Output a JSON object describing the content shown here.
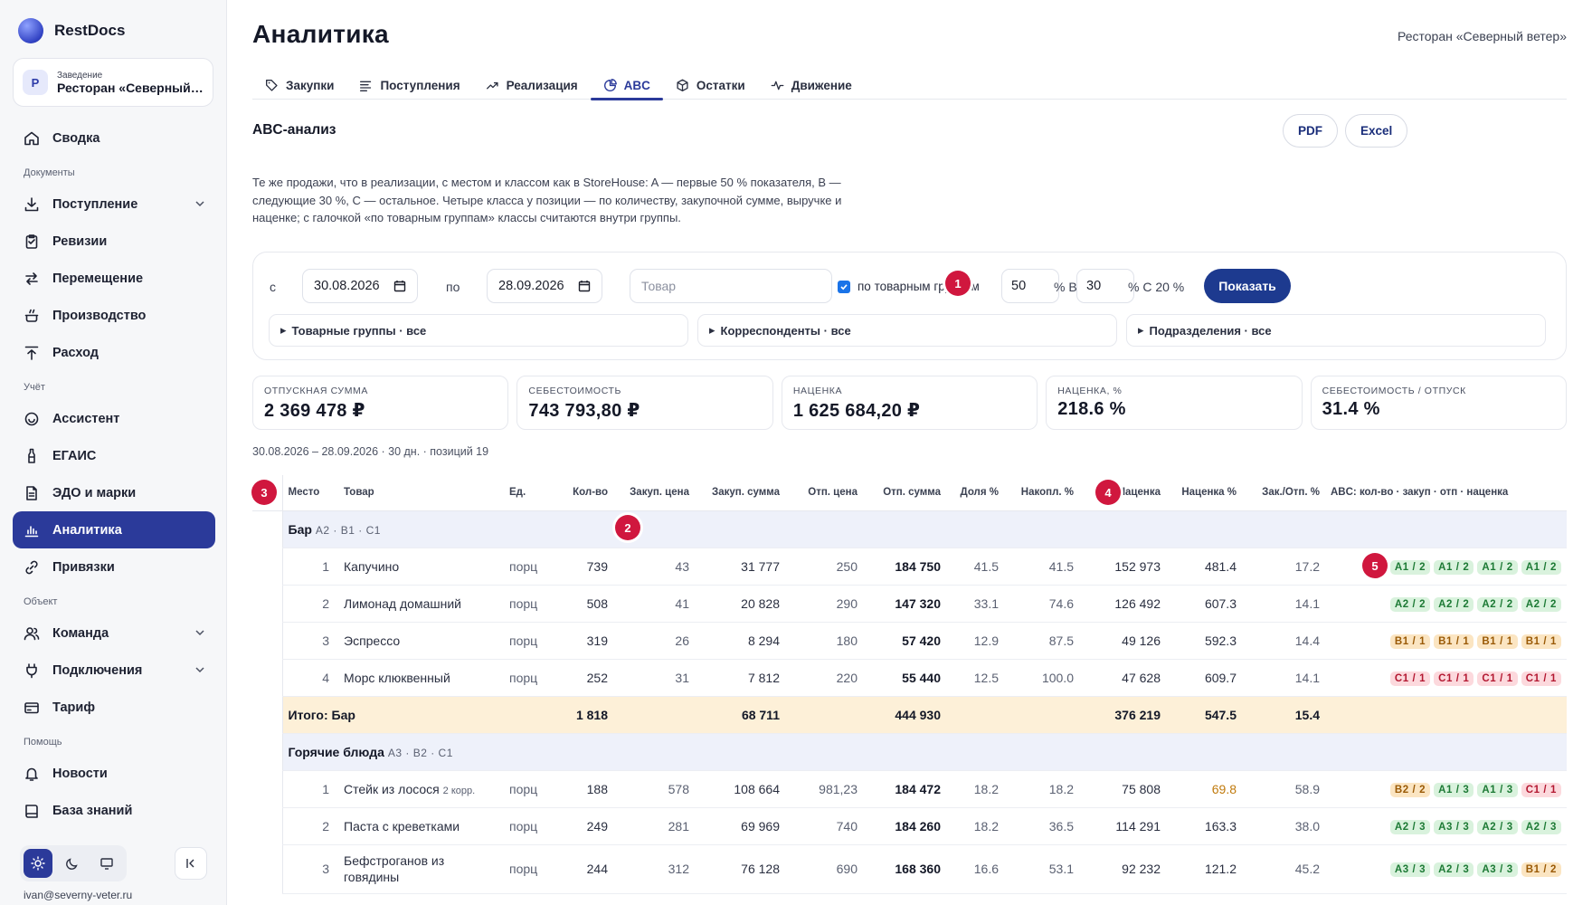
{
  "app": {
    "name": "RestDocs"
  },
  "venue": {
    "label": "Заведение",
    "name": "Ресторан «Северный ветер»",
    "initial": "Р"
  },
  "sidebar": {
    "items": [
      {
        "label": "Сводка",
        "icon": "home-icon"
      },
      {
        "section": "Документы"
      },
      {
        "label": "Поступление",
        "icon": "download-icon",
        "expandable": true
      },
      {
        "label": "Ревизии",
        "icon": "clipboard-icon"
      },
      {
        "label": "Перемещение",
        "icon": "transfer-icon"
      },
      {
        "label": "Производство",
        "icon": "pot-icon"
      },
      {
        "label": "Расход",
        "icon": "upload-icon"
      },
      {
        "section": "Учёт"
      },
      {
        "label": "Ассистент",
        "icon": "assistant-icon"
      },
      {
        "label": "ЕГАИС",
        "icon": "bottle-icon"
      },
      {
        "label": "ЭДО и марки",
        "icon": "document-icon"
      },
      {
        "label": "Аналитика",
        "icon": "chart-icon",
        "active": true
      },
      {
        "label": "Привязки",
        "icon": "link-icon"
      },
      {
        "section": "Объект"
      },
      {
        "label": "Команда",
        "icon": "team-icon",
        "expandable": true
      },
      {
        "label": "Подключения",
        "icon": "plug-icon",
        "expandable": true
      },
      {
        "label": "Тариф",
        "icon": "card-icon"
      },
      {
        "section": "Помощь"
      },
      {
        "label": "Новости",
        "icon": "bell-icon"
      },
      {
        "label": "База знаний",
        "icon": "book-icon"
      }
    ],
    "user_email": "ivan@severny-veter.ru"
  },
  "header": {
    "title": "Аналитика",
    "venue": "Ресторан «Северный ветер»"
  },
  "tabs": [
    {
      "label": "Закупки",
      "icon": "tag-icon"
    },
    {
      "label": "Поступления",
      "icon": "list-icon"
    },
    {
      "label": "Реализация",
      "icon": "trend-icon"
    },
    {
      "label": "ABC",
      "icon": "pie-icon",
      "active": true
    },
    {
      "label": "Остатки",
      "icon": "box-icon"
    },
    {
      "label": "Движение",
      "icon": "pulse-icon"
    }
  ],
  "section": {
    "title": "ABC-анализ",
    "pdf_label": "PDF",
    "excel_label": "Excel",
    "description": "Те же продажи, что в реализации, с местом и классом как в StoreHouse: A — первые 50 % показателя, B — следующие 30 %, C — остальное. Четыре класса у позиции — по количеству, закупочной сумме, выручке и наценке; с галочкой «по товарным группам» классы считаются внутри группы."
  },
  "filters": {
    "from_label": "с",
    "from_date": "30.08.2026",
    "to_label": "по",
    "to_date": "28.09.2026",
    "product_placeholder": "Товар",
    "by_groups_label": "по товарным группам",
    "by_groups_checked": true,
    "a_value": "50",
    "b_label": "% B",
    "b_value": "30",
    "c_label": "% C 20 %",
    "show_label": "Показать",
    "groups_filter": "Товарные группы · все",
    "correspondents_filter": "Корреспонденты · все",
    "departments_filter": "Подразделения · все"
  },
  "markers": [
    "1",
    "2",
    "3",
    "4",
    "5"
  ],
  "stats": [
    {
      "label": "ОТПУСКНАЯ СУММА",
      "value": "2 369 478 ₽"
    },
    {
      "label": "СЕБЕСТОИМОСТЬ",
      "value": "743 793,80 ₽"
    },
    {
      "label": "НАЦЕНКА",
      "value": "1 625 684,20 ₽"
    },
    {
      "label": "НАЦЕНКА, %",
      "value": "218.6 %"
    },
    {
      "label": "СЕБЕСТОИМОСТЬ / ОТПУСК",
      "value": "31.4 %"
    }
  ],
  "period": "30.08.2026 – 28.09.2026 · 30 дн. · позиций 19",
  "table": {
    "columns": [
      "Место",
      "Товар",
      "Ед.",
      "Кол-во",
      "Закуп. цена",
      "Закуп. сумма",
      "Отп. цена",
      "Отп. сумма",
      "Доля %",
      "Накопл. %",
      "Наценка",
      "Наценка %",
      "Зак./Отп. %",
      "ABC: кол-во · закуп · отп · наценка"
    ],
    "groups": [
      {
        "name": "Бар",
        "classes": "A2 · B1 · C1",
        "rows": [
          {
            "place": "1",
            "name": "Капучино",
            "unit": "порц",
            "qty": "739",
            "buy_price": "43",
            "buy_sum": "31 777",
            "sell_price": "250",
            "sell_sum": "184 750",
            "share": "41.5",
            "cum": "41.5",
            "markup": "152 973",
            "markup_pct": "481.4",
            "ratio": "17.2",
            "abc": [
              "A1 / 2",
              "A1 / 2",
              "A1 / 2",
              "A1 / 2"
            ]
          },
          {
            "place": "2",
            "name": "Лимонад домашний",
            "unit": "порц",
            "qty": "508",
            "buy_price": "41",
            "buy_sum": "20 828",
            "sell_price": "290",
            "sell_sum": "147 320",
            "share": "33.1",
            "cum": "74.6",
            "markup": "126 492",
            "markup_pct": "607.3",
            "ratio": "14.1",
            "abc": [
              "A2 / 2",
              "A2 / 2",
              "A2 / 2",
              "A2 / 2"
            ]
          },
          {
            "place": "3",
            "name": "Эспрессо",
            "unit": "порц",
            "qty": "319",
            "buy_price": "26",
            "buy_sum": "8 294",
            "sell_price": "180",
            "sell_sum": "57 420",
            "share": "12.9",
            "cum": "87.5",
            "markup": "49 126",
            "markup_pct": "592.3",
            "ratio": "14.4",
            "abc": [
              "B1 / 1",
              "B1 / 1",
              "B1 / 1",
              "B1 / 1"
            ]
          },
          {
            "place": "4",
            "name": "Морс клюквенный",
            "unit": "порц",
            "qty": "252",
            "buy_price": "31",
            "buy_sum": "7 812",
            "sell_price": "220",
            "sell_sum": "55 440",
            "share": "12.5",
            "cum": "100.0",
            "markup": "47 628",
            "markup_pct": "609.7",
            "ratio": "14.1",
            "abc": [
              "C1 / 1",
              "C1 / 1",
              "C1 / 1",
              "C1 / 1"
            ]
          }
        ],
        "total": {
          "label": "Итого: Бар",
          "qty": "1 818",
          "buy_sum": "68 711",
          "sell_sum": "444 930",
          "markup": "376 219",
          "markup_pct": "547.5",
          "ratio": "15.4"
        }
      },
      {
        "name": "Горячие блюда",
        "classes": "A3 · B2 · C1",
        "rows": [
          {
            "place": "1",
            "name": "Стейк из лосося",
            "sub": "2 корр.",
            "unit": "порц",
            "qty": "188",
            "buy_price": "578",
            "buy_sum": "108 664",
            "sell_price": "981,23",
            "sell_sum": "184 472",
            "share": "18.2",
            "cum": "18.2",
            "markup": "75 808",
            "markup_pct": "69.8",
            "markup_warn": true,
            "ratio": "58.9",
            "abc": [
              "B2 / 2",
              "A1 / 3",
              "A1 / 3",
              "C1 / 1"
            ]
          },
          {
            "place": "2",
            "name": "Паста с креветками",
            "unit": "порц",
            "qty": "249",
            "buy_price": "281",
            "buy_sum": "69 969",
            "sell_price": "740",
            "sell_sum": "184 260",
            "share": "18.2",
            "cum": "36.5",
            "markup": "114 291",
            "markup_pct": "163.3",
            "ratio": "38.0",
            "abc": [
              "A2 / 3",
              "A3 / 3",
              "A2 / 3",
              "A2 / 3"
            ]
          },
          {
            "place": "3",
            "name": "Бефстроганов из говядины",
            "unit": "порц",
            "qty": "244",
            "buy_price": "312",
            "buy_sum": "76 128",
            "sell_price": "690",
            "sell_sum": "168 360",
            "share": "16.6",
            "cum": "53.1",
            "markup": "92 232",
            "markup_pct": "121.2",
            "ratio": "45.2",
            "abc": [
              "A3 / 3",
              "A2 / 3",
              "A3 / 3",
              "B1 / 2"
            ]
          }
        ]
      }
    ]
  }
}
